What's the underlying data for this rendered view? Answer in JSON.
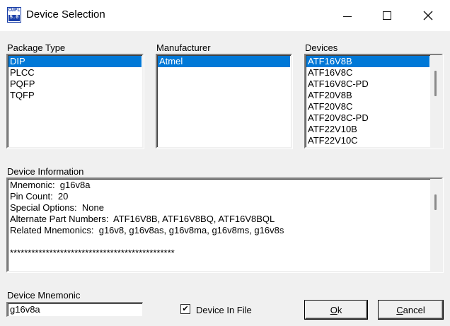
{
  "window": {
    "title": "Device Selection",
    "icon_top": "CUPL",
    "icon_bottom": "5.0"
  },
  "package_type": {
    "label": "Package Type",
    "items": [
      "DIP",
      "PLCC",
      "PQFP",
      "TQFP"
    ],
    "selected": "DIP"
  },
  "manufacturer": {
    "label": "Manufacturer",
    "items": [
      "Atmel"
    ],
    "selected": "Atmel"
  },
  "devices": {
    "label": "Devices",
    "items": [
      "ATF16V8B",
      "ATF16V8C",
      "ATF16V8C-PD",
      "ATF20V8B",
      "ATF20V8C",
      "ATF20V8C-PD",
      "ATF22V10B",
      "ATF22V10C"
    ],
    "selected": "ATF16V8B"
  },
  "device_information": {
    "label": "Device Information",
    "lines": [
      "Mnemonic:  g16v8a",
      "Pin Count:  20",
      "Special Options:  None",
      "Alternate Part Numbers:  ATF16V8B, ATF16V8BQ, ATF16V8BQL",
      "Related Mnemonics:  g16v8, g16v8as, g16v8ma, g16v8ms, g16v8s",
      "",
      "**********************************************"
    ]
  },
  "device_mnemonic": {
    "label": "Device Mnemonic",
    "value": "g16v8a"
  },
  "device_in_file": {
    "label": "Device In File",
    "checked": true
  },
  "buttons": {
    "ok_label": "Ok",
    "cancel_label": "Cancel"
  }
}
